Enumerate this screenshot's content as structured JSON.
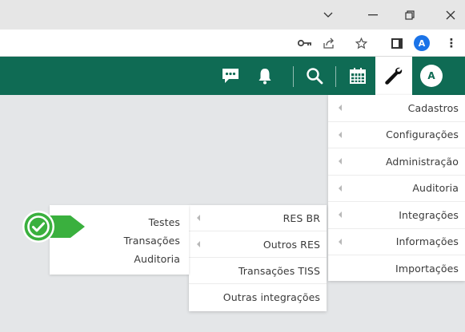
{
  "window_controls": {
    "chevron": "⌵",
    "minimize": "—",
    "restore": "⧉",
    "close": "✕"
  },
  "toolbar": {
    "key_icon": "key-icon",
    "share_icon": "share-icon",
    "star_icon": "star-icon",
    "panel_icon": "side-panel-icon",
    "profile_initial": "A",
    "more_icon": "⋮"
  },
  "appbar": {
    "background": "#0f6b54",
    "icons": [
      "chat-icon",
      "bell-icon",
      "search-icon",
      "calendar-icon",
      "wrench-icon"
    ],
    "user_initial": "A"
  },
  "main_menu": {
    "items": [
      {
        "label": "Cadastros",
        "has_submenu": true
      },
      {
        "label": "Configurações",
        "has_submenu": true
      },
      {
        "label": "Administração",
        "has_submenu": true
      },
      {
        "label": "Auditoria",
        "has_submenu": true
      },
      {
        "label": "Integrações",
        "has_submenu": true
      },
      {
        "label": "Informações",
        "has_submenu": true
      },
      {
        "label": "Importações",
        "has_submenu": false
      }
    ]
  },
  "integrations_submenu": {
    "items": [
      {
        "label": "RES BR",
        "has_submenu": true
      },
      {
        "label": "Outros RES",
        "has_submenu": true
      },
      {
        "label": "Transações TISS",
        "has_submenu": false
      },
      {
        "label": "Outras integrações",
        "has_submenu": false
      }
    ]
  },
  "res_br_submenu": {
    "items": [
      {
        "label": "Testes"
      },
      {
        "label": "Transações"
      },
      {
        "label": "Auditoria"
      }
    ]
  },
  "badge": {
    "icon": "check-icon",
    "color": "#3ab03e"
  }
}
